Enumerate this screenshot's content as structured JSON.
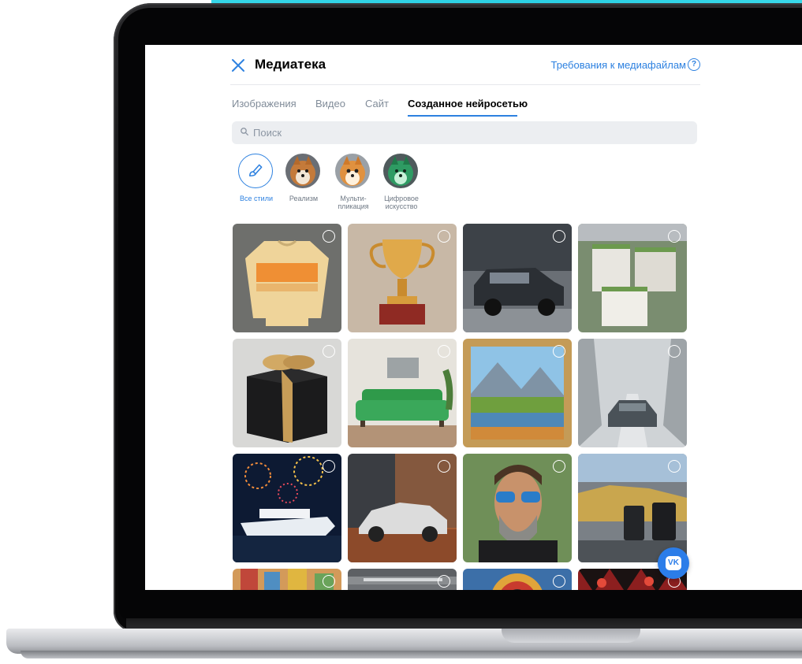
{
  "header": {
    "title": "Медиатека",
    "requirements_link": "Требования к медиафайлам",
    "help_glyph": "?"
  },
  "tabs": [
    {
      "label": "Изображения",
      "active": false
    },
    {
      "label": "Видео",
      "active": false
    },
    {
      "label": "Сайт",
      "active": false
    },
    {
      "label": "Созданное нейросетью",
      "active": true
    }
  ],
  "search": {
    "placeholder": "Поиск"
  },
  "styles": [
    {
      "label": "Все стили",
      "icon": "brush-icon",
      "active": true
    },
    {
      "label": "Реализм",
      "icon": "dog-realism-thumbnail",
      "active": false
    },
    {
      "label": "Мульти-\nпликация",
      "icon": "dog-cartoon-thumbnail",
      "active": false
    },
    {
      "label": "Цифровое\nискусство",
      "icon": "dog-digital-art-thumbnail",
      "active": false
    }
  ],
  "gallery": {
    "items": [
      {
        "subject": "sweater",
        "selected": false
      },
      {
        "subject": "trophy",
        "selected": false
      },
      {
        "subject": "suv-car",
        "selected": false
      },
      {
        "subject": "apartment-buildings",
        "selected": false
      },
      {
        "subject": "gift-box",
        "selected": false
      },
      {
        "subject": "green-sofa",
        "selected": false
      },
      {
        "subject": "landscape-painting",
        "selected": false
      },
      {
        "subject": "car-in-snow",
        "selected": false
      },
      {
        "subject": "cruise-ship-fireworks",
        "selected": false
      },
      {
        "subject": "painted-sports-car",
        "selected": false
      },
      {
        "subject": "man-with-sunglasses",
        "selected": false
      },
      {
        "subject": "cars-and-chargers",
        "selected": false
      },
      {
        "subject": "colorful-city",
        "selected": false
      },
      {
        "subject": "garage-interior",
        "selected": false
      },
      {
        "subject": "ornamental-pattern",
        "selected": false
      },
      {
        "subject": "red-pattern",
        "selected": false
      }
    ]
  },
  "floating_button": {
    "label": "VK",
    "icon": "vk-logo"
  },
  "colors": {
    "accent": "#2d81e0",
    "screen_bg": "#ffffff",
    "search_bg": "#eceef1",
    "brand_strip": "#35d6e8"
  }
}
